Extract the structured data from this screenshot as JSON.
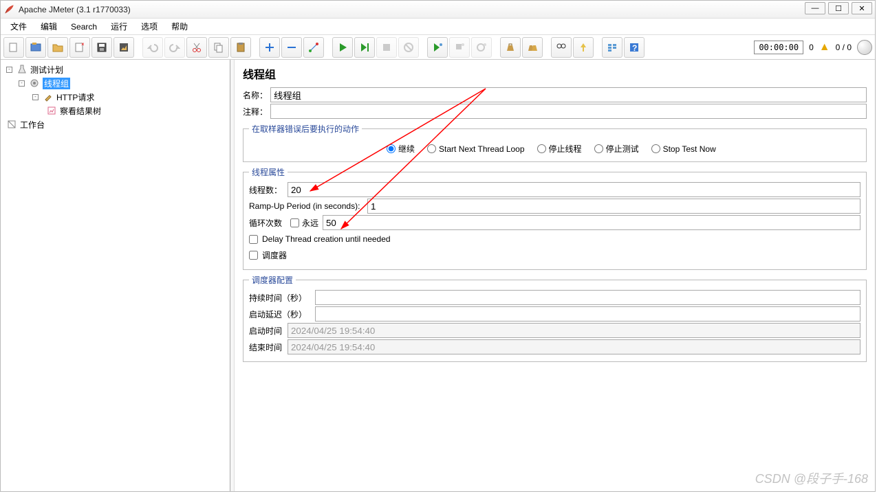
{
  "window": {
    "title": "Apache JMeter (3.1 r1770033)"
  },
  "menu": {
    "file": "文件",
    "edit": "编辑",
    "search": "Search",
    "run": "运行",
    "options": "选项",
    "help": "帮助"
  },
  "status": {
    "timer": "00:00:00",
    "zero": "0",
    "ratio": "0 / 0"
  },
  "tree": {
    "test_plan": "测试计划",
    "thread_group": "线程组",
    "http_request": "HTTP请求",
    "view_results": "察看结果树",
    "workbench": "工作台"
  },
  "form": {
    "panel_title": "线程组",
    "name_label": "名称：",
    "name_value": "线程组",
    "comment_label": "注释：",
    "comment_value": "",
    "error_action_legend": "在取样器错误后要执行的动作",
    "radios": {
      "continue": "继续",
      "start_next": "Start Next Thread Loop",
      "stop_thread": "停止线程",
      "stop_test": "停止测试",
      "stop_now": "Stop Test Now"
    },
    "thread_props_legend": "线程属性",
    "threads_label": "线程数：",
    "threads_value": "20",
    "rampup_label": "Ramp-Up Period (in seconds):",
    "rampup_value": "1",
    "loop_label": "循环次数",
    "forever_label": "永远",
    "loop_value": "50",
    "delay_label": "Delay Thread creation until needed",
    "scheduler_label": "调度器",
    "sched_legend": "调度器配置",
    "duration_label": "持续时间（秒）",
    "startup_delay_label": "启动延迟（秒）",
    "start_time_label": "启动时间",
    "start_time_value": "2024/04/25 19:54:40",
    "end_time_label": "结束时间",
    "end_time_value": "2024/04/25 19:54:40"
  },
  "watermark": "CSDN @段子手-168"
}
